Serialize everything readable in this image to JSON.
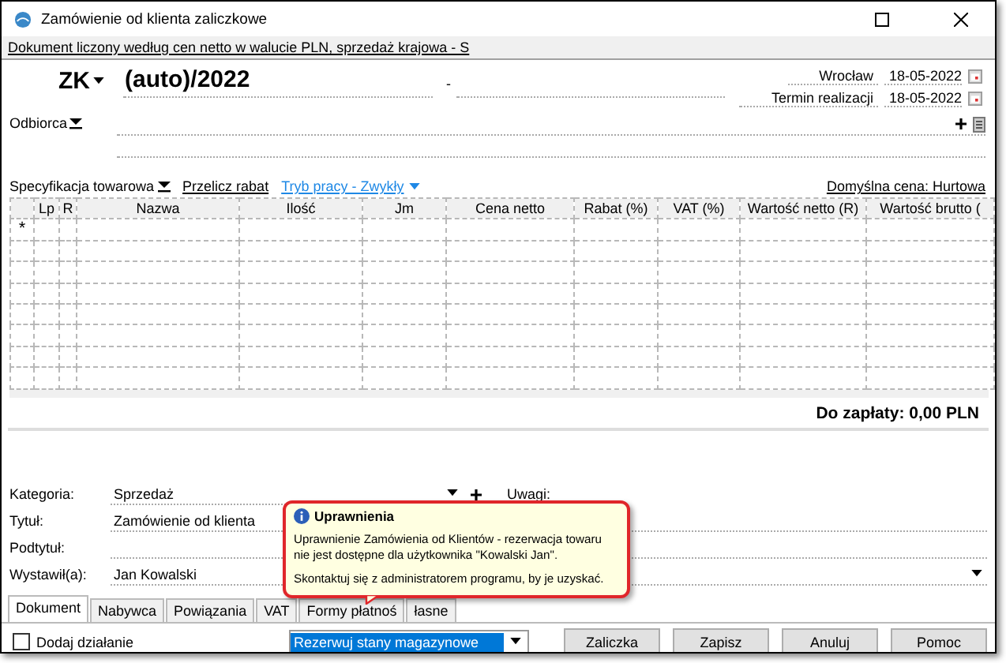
{
  "window": {
    "title": "Zamówienie od klienta zaliczkowe"
  },
  "info_line": "Dokument liczony według cen netto w walucie PLN, sprzedaż krajowa - S",
  "document": {
    "type": "ZK",
    "number": "(auto)/2022",
    "separator": "-"
  },
  "dates": [
    {
      "label": "Wrocław",
      "value": "18-05-2022"
    },
    {
      "label": "Termin realizacji",
      "value": "18-05-2022"
    }
  ],
  "recipient": {
    "label": "Odbiorca"
  },
  "toolbar": [
    {
      "label": "Specyfikacja towarowa",
      "kind": "menu"
    },
    {
      "label": "Przelicz rabat",
      "kind": "link"
    },
    {
      "label": "Tryb pracy - Zwykły",
      "kind": "bluemenu"
    }
  ],
  "default_price": "Domyślna cena: Hurtowa",
  "table": {
    "columns": [
      "Lp",
      "R",
      "Nazwa",
      "Ilość",
      "Jm",
      "Cena netto",
      "Rabat (%)",
      "VAT (%)",
      "Wartość netto (R)",
      "Wartość brutto ("
    ],
    "new_row_marker": "*"
  },
  "total": "Do zapłaty: 0,00 PLN",
  "fields": [
    {
      "label": "Kategoria:",
      "value": "Sprzedaż",
      "kind": "combo"
    },
    {
      "label": "Tytuł:",
      "value": "Zamówienie od klienta",
      "kind": "text"
    },
    {
      "label": "Podtytuł:",
      "kind": "text"
    },
    {
      "label": "Wystawił(a):",
      "value": "Jan Kowalski",
      "kind": "wide"
    }
  ],
  "notes_label": "Uwagi:",
  "tabs": [
    {
      "label": "Dokument",
      "selected": true
    },
    {
      "label": "Nabywca",
      "selected": false
    },
    {
      "label": "Powiązania",
      "selected": false
    },
    {
      "label": "VAT",
      "selected": false
    },
    {
      "label": "Formy płatnoś",
      "selected": false
    },
    {
      "label": "łasne",
      "selected": false
    }
  ],
  "add_action": {
    "label": "Dodaj działanie",
    "checked": false
  },
  "reservation": {
    "value": "Rezerwuj stany magazynowe"
  },
  "buttons": [
    "Zaliczka",
    "Zapisz",
    "Anuluj",
    "Pomoc"
  ],
  "tooltip": {
    "title": "Uprawnienia",
    "lines": [
      "Uprawnienie Zamówienia od Klientów - rezerwacja towaru nie jest dostępne dla użytkownika \"Kowalski Jan\".",
      "Skontaktuj się z administratorem programu, by je uzyskać."
    ]
  }
}
